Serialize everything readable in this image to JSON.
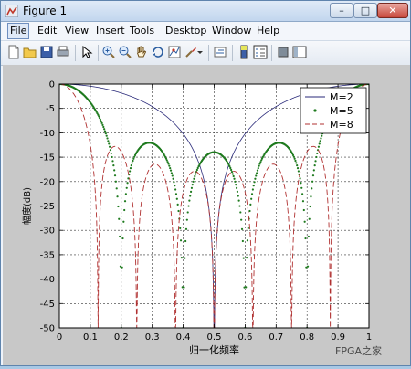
{
  "window": {
    "title": "Figure 1",
    "controls": {
      "minimize": "–",
      "maximize": "□",
      "close": "✕"
    }
  },
  "menu": [
    {
      "label": "File",
      "selected": true
    },
    {
      "label": "Edit"
    },
    {
      "label": "View"
    },
    {
      "label": "Insert"
    },
    {
      "label": "Tools"
    },
    {
      "label": "Desktop"
    },
    {
      "label": "Window"
    },
    {
      "label": "Help"
    }
  ],
  "toolbar": [
    "new-figure-icon",
    "open-file-icon",
    "save-icon",
    "print-icon",
    "select-arrow-icon",
    "zoom-in-icon",
    "zoom-out-icon",
    "pan-hand-icon",
    "rotate-3d-icon",
    "data-cursor-icon",
    "brush-icon",
    "link-plot-icon",
    "colorbar-icon",
    "legend-icon",
    "hide-plot-tools-icon",
    "show-plot-tools-icon"
  ],
  "watermark": "FPGA之家",
  "chart_data": {
    "type": "line",
    "xlabel": "归一化频率",
    "ylabel": "幅度(dB)",
    "xlim": [
      0,
      1
    ],
    "ylim": [
      -50,
      0
    ],
    "xticks": [
      0,
      0.1,
      0.2,
      0.3,
      0.4,
      0.5,
      0.6,
      0.7,
      0.8,
      0.9,
      1
    ],
    "yticks": [
      0,
      -5,
      -10,
      -15,
      -20,
      -25,
      -30,
      -35,
      -40,
      -45,
      -50
    ],
    "grid": true,
    "legend_position": "top-right",
    "series": [
      {
        "name": "M=2",
        "style": "solid",
        "marker": "none",
        "color": "#2a2a7a",
        "M": 2
      },
      {
        "name": "M=5",
        "style": "none",
        "marker": "dot",
        "color": "#1e7a1e",
        "M": 5
      },
      {
        "name": "M=8",
        "style": "dashed",
        "marker": "none",
        "color": "#b03030",
        "M": 8
      }
    ]
  }
}
